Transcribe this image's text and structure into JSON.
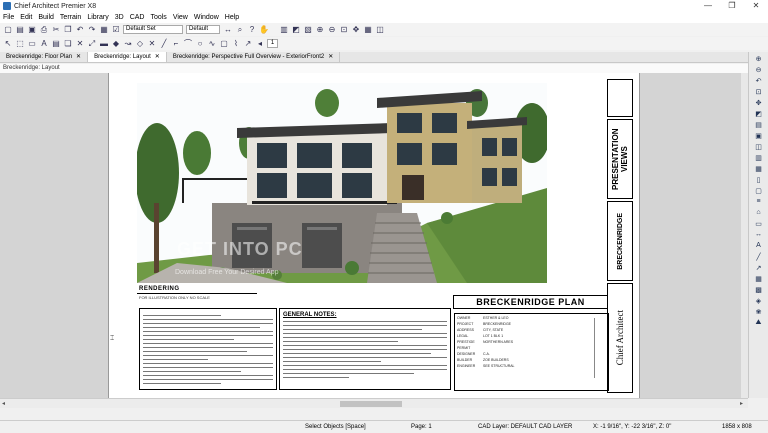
{
  "window": {
    "title": "Chief Architect Premier X8",
    "controls": [
      "—",
      "❐",
      "✕"
    ]
  },
  "menu": [
    "File",
    "Edit",
    "Build",
    "Terrain",
    "Library",
    "3D",
    "CAD",
    "Tools",
    "View",
    "Window",
    "Help"
  ],
  "toolbar": {
    "layer_set": "Default Set",
    "style": "Default",
    "page_number": "1"
  },
  "tabs": [
    {
      "label": "Breckenridge: Floor Plan",
      "active": false
    },
    {
      "label": "Breckenridge: Layout",
      "active": true
    },
    {
      "label": "Breckenridge: Perspective Full Overview - ExteriorFront2",
      "active": false
    }
  ],
  "breadcrumb": "Breckenridge: Layout",
  "sheet": {
    "watermark": "GET INTO PC",
    "watermark_sub": "Download Free Your Desired App",
    "render_label": "RENDERING",
    "render_sub": "FOR ILLUSTRATION ONLY          NO SCALE",
    "general_notes_title": "GENERAL NOTES:",
    "plan_title": "BRECKENRIDGE PLAN",
    "presentation_views": "PRESENTATION VIEWS",
    "plan_name_vertical": "BRECKENRIDGE",
    "logo_text": "Chief Architect",
    "project_rows": [
      {
        "k": "OWNER",
        "v": "ESTHER & LEO"
      },
      {
        "k": "PROJECT",
        "v": "BRECKENRIDGE"
      },
      {
        "k": "ADDRESS",
        "v": "CITY, STATE"
      },
      {
        "k": "LEGAL",
        "v": "LOT 1 BLK 1"
      },
      {
        "k": "PRESTIGE",
        "v": "NORTHERN ARES"
      },
      {
        "k": "PERMIT",
        "v": ""
      },
      {
        "k": "DESIGNER",
        "v": "C.A."
      },
      {
        "k": "BUILDER",
        "v": "ZOE BUILDERS"
      },
      {
        "k": "ENGINEER",
        "v": "SEE STRUCTURAL"
      }
    ]
  },
  "status": {
    "mode": "Select Objects [Space]",
    "page": "Page: 1",
    "layer": "CAD Layer:  DEFAULT CAD LAYER",
    "coords": "X: -1 9/16\", Y: -22 3/16\", Z: 0\"",
    "size": "1858 x 808"
  },
  "colors": {
    "accent": "#2c6fb5",
    "sky": "#e6eef6",
    "grass": "#6f9a45",
    "siding": "#c4b07a"
  }
}
